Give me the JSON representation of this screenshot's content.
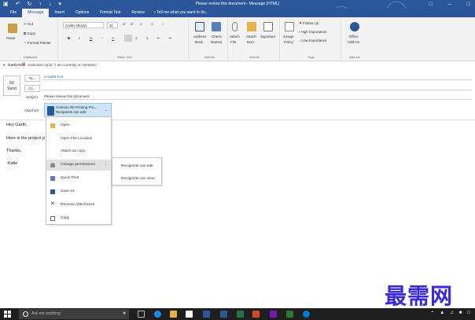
{
  "window": {
    "title": "Please review this document - Message (HTML)",
    "qat_icons": [
      "save-icon",
      "undo-icon",
      "redo-icon",
      "up-icon",
      "down-icon",
      "customize-icon"
    ],
    "controls": [
      "minimize-icon",
      "restore-icon",
      "close-icon"
    ]
  },
  "ribbon_tabs": [
    {
      "label": "File"
    },
    {
      "label": "Message"
    },
    {
      "label": "Insert"
    },
    {
      "label": "Options"
    },
    {
      "label": "Format Text"
    },
    {
      "label": "Review"
    }
  ],
  "tell_me": "Tell me what you want to do...",
  "ribbon": {
    "clipboard": {
      "paste": "Paste",
      "cut": "Cut",
      "copy": "Copy",
      "format_painter": "Format Painter",
      "label": "Clipboard"
    },
    "basic_text": {
      "font": "Calibri (Body)",
      "size": "11",
      "label": "Basic Text"
    },
    "names": {
      "address_book_1": "Address",
      "address_book_2": "Book",
      "check_names_1": "Check",
      "check_names_2": "Names",
      "label": "Names"
    },
    "include": {
      "attach_file_1": "Attach",
      "attach_file_2": "File",
      "attach_item_1": "Attach",
      "attach_item_2": "Item",
      "signature": "Signature",
      "label": "Include"
    },
    "tags": {
      "assign_policy_1": "Assign",
      "assign_policy_2": "Policy",
      "follow_up": "Follow Up",
      "high_importance": "High Importance",
      "low_importance": "Low Importance",
      "label": "Tags"
    },
    "addins": {
      "office_addins_1": "Office",
      "office_addins_2": "Add-ins",
      "label": "Add-ins"
    }
  },
  "infobar": {
    "sender": "Garth Fort",
    "message": "Automatic reply: \"I am currently on vacation\""
  },
  "header": {
    "send": "Send",
    "to_button": "To...",
    "cc_button": "Cc...",
    "to_value": "Garth Fort",
    "subject_label": "Subject",
    "subject_value": "Please review this document",
    "attached_label": "Attached"
  },
  "attachment": {
    "name": "Contoso 3D Printing Pro...",
    "permission": "Recipients can edit"
  },
  "body_lines": [
    "Hey Garth,",
    "Here is the project p",
    "Thanks,",
    "-Katie"
  ],
  "context_menu": [
    {
      "label": "Open",
      "icon": "open-icon"
    },
    {
      "label": "Open File Location",
      "icon": ""
    },
    {
      "label": "Attach as copy",
      "icon": ""
    },
    {
      "label": "Change permissions",
      "icon": "permissions-icon",
      "submenu": true
    },
    {
      "label": "Quick Print",
      "icon": "print-icon"
    },
    {
      "label": "Save As",
      "icon": "save-as-icon"
    },
    {
      "label": "Remove Attachment",
      "icon": "remove-icon"
    },
    {
      "label": "Copy",
      "icon": "copy-icon"
    }
  ],
  "submenu": [
    {
      "label": "Recipients can edit"
    },
    {
      "label": "Recipients can view"
    }
  ],
  "watermark": "最需网",
  "taskbar": {
    "search_placeholder": "Ask me anything"
  }
}
